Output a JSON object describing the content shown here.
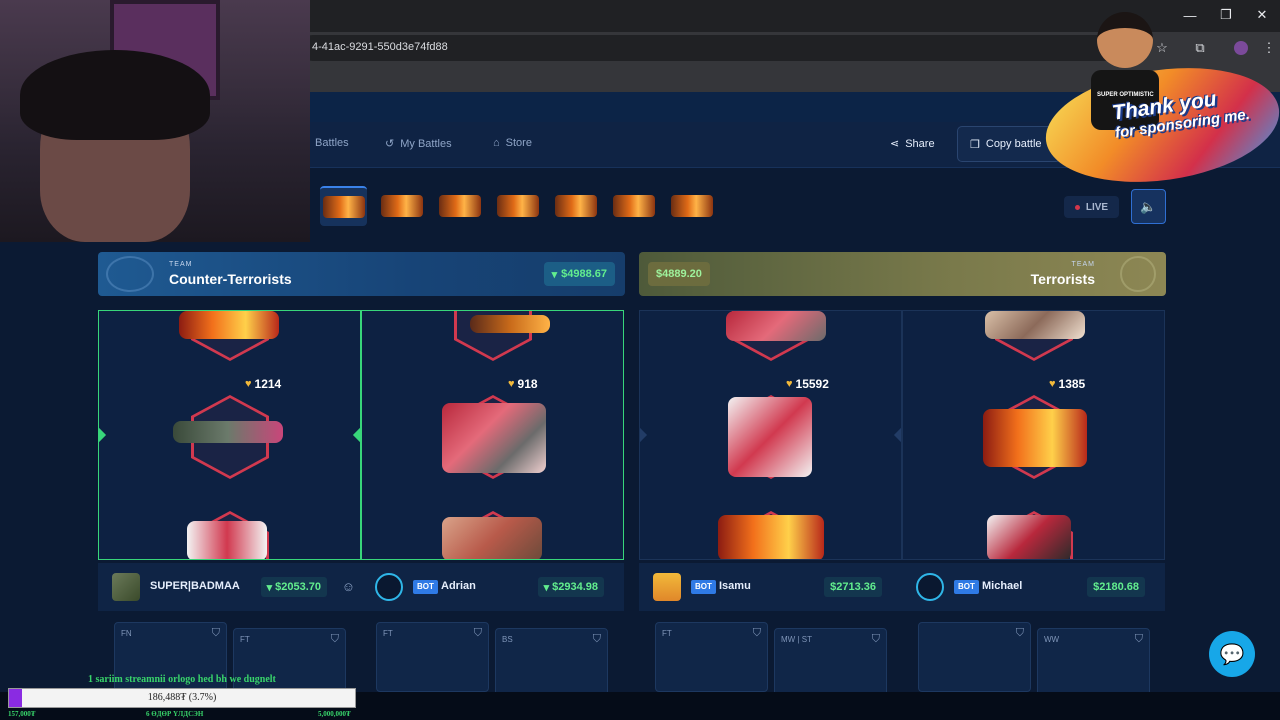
{
  "browser": {
    "url_fragment": "4-41ac-9291-550d3e74fd88",
    "window_controls": [
      "—",
      "❐",
      "✕"
    ]
  },
  "nav": {
    "battles_label": "Battles",
    "my_battles_label": "My Battles",
    "store_label": "Store",
    "share_label": "Share",
    "copy_battle_label": "Copy battle"
  },
  "stream": {
    "live_label": "LIVE",
    "case_count": 7
  },
  "teams": {
    "ct": {
      "label": "TEAM",
      "name": "Counter-Terrorists",
      "total": "$4988.67"
    },
    "t": {
      "label": "TEAM",
      "name": "Terrorists",
      "total": "$4889.20"
    }
  },
  "reels": [
    {
      "value": "1214"
    },
    {
      "value": "918"
    },
    {
      "value": "15592"
    },
    {
      "value": "1385"
    }
  ],
  "players": [
    {
      "name": "SUPER|BADMAA",
      "total": "$2053.70",
      "bot": ""
    },
    {
      "name": "Adrian",
      "total": "$2934.98",
      "bot": "BOT"
    },
    {
      "name": "Isamu",
      "total": "$2713.36",
      "bot": "BOT"
    },
    {
      "name": "Michael",
      "total": "$2180.68",
      "bot": "BOT"
    }
  ],
  "loot_wear": [
    "FN",
    "FT",
    "FT",
    "BS",
    "FT",
    "MW | ST",
    "",
    "WW"
  ],
  "overlay": {
    "sponsor_line1": "Thank you",
    "sponsor_line2": "for sponsoring me.",
    "kid_shirt": "SUPER OPTIMISTIC",
    "donation_message": "1 sariim streamnii orlogo hed bh we dugnelt",
    "donation_amount": "186,488₮ (3.7%)",
    "donation_start": "157,000₮",
    "donation_days": "6 ӨДӨР ҮЛДСЭН",
    "donation_goal": "5,000,000₮",
    "donation_progress": 0.037
  },
  "colors": {
    "accent_green": "#62ee8e",
    "ct_blue": "#1f5a92",
    "t_olive": "#7a7a4b",
    "hex_red": "#d1394f"
  }
}
